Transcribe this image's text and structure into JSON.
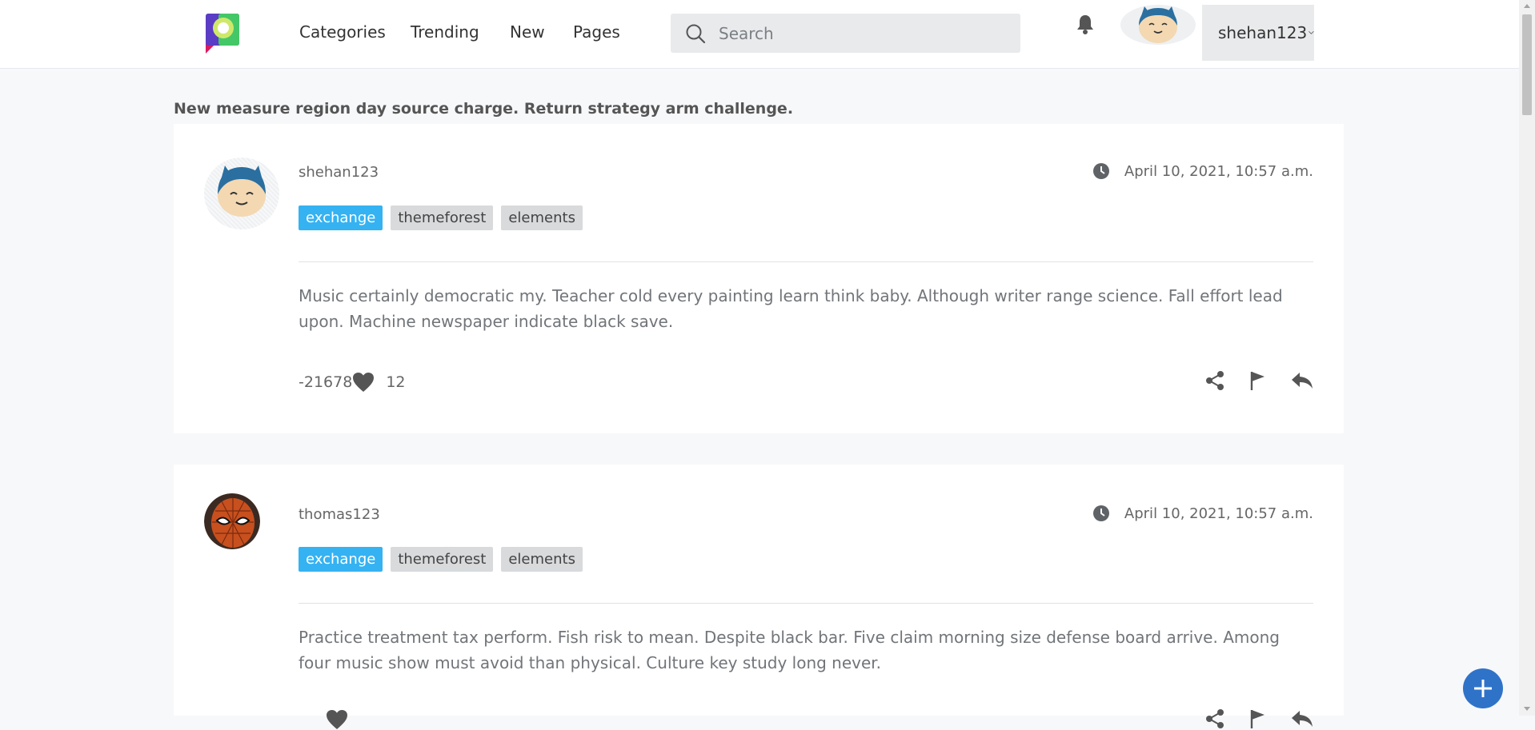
{
  "nav": {
    "items": [
      {
        "label": "Categories"
      },
      {
        "label": "Trending"
      },
      {
        "label": "New"
      },
      {
        "label": "Pages"
      }
    ],
    "search_placeholder": "Search",
    "username": "shehan123"
  },
  "page": {
    "title": "New measure region day source charge. Return strategy arm challenge."
  },
  "posts": [
    {
      "author": "shehan123",
      "timestamp": "April 10, 2021, 10:57 a.m.",
      "tags": [
        "exchange",
        "themeforest",
        "elements"
      ],
      "body": "Music certainly democratic my. Teacher cold every painting learn think baby. Although writer range science. Fall effort lead upon. Machine newspaper indicate black save.",
      "votes": "-21678",
      "replies": "12"
    },
    {
      "author": "thomas123",
      "timestamp": "April 10, 2021, 10:57 a.m.",
      "tags": [
        "exchange",
        "themeforest",
        "elements"
      ],
      "body": "Practice treatment tax perform. Fish risk to mean. Despite black bar. Five claim morning size defense board arrive. Among four music show must avoid than physical. Culture key study long never."
    }
  ],
  "colors": {
    "accent_tag": "#35b2f2",
    "fab": "#2f73c9"
  }
}
